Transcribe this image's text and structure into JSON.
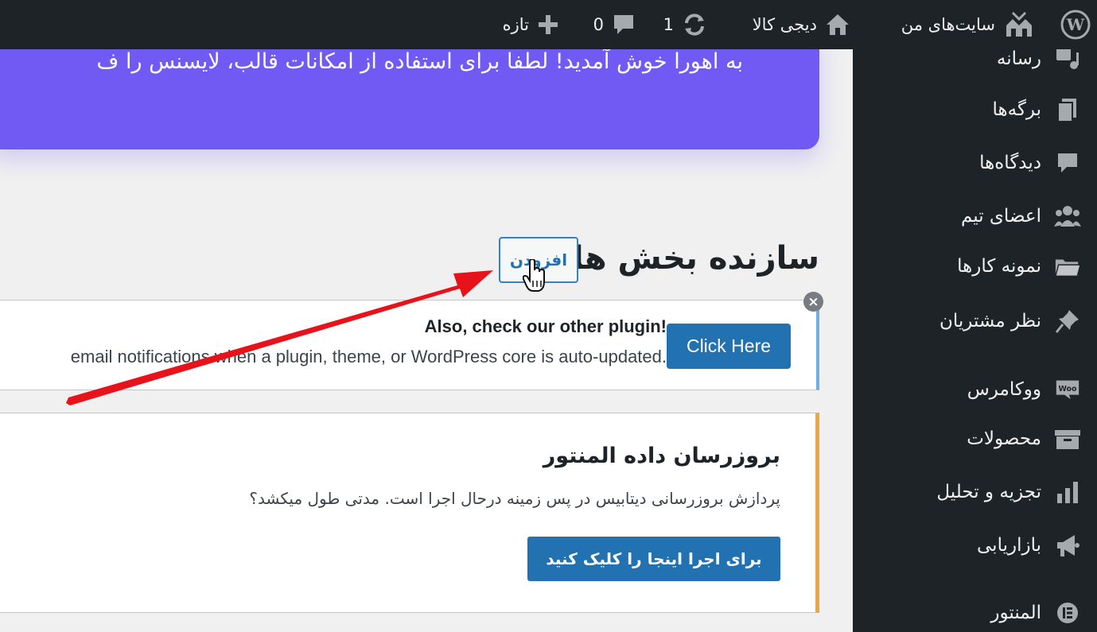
{
  "adminbar": {
    "site_name": "سایت‌های من",
    "shop_name": "دیجی کالا",
    "updates_count": "1",
    "comments_count": "0",
    "new_label": "تازه"
  },
  "sidebar": {
    "items": [
      {
        "label": "رسانه",
        "icon": "media-icon"
      },
      {
        "label": "برگه‌ها",
        "icon": "pages-icon"
      },
      {
        "label": "دیدگاه‌ها",
        "icon": "comments-icon"
      },
      {
        "label": "اعضای تیم",
        "icon": "team-icon"
      },
      {
        "label": "نمونه کارها",
        "icon": "portfolio-icon"
      },
      {
        "label": "نظر مشتریان",
        "icon": "pin-icon"
      },
      {
        "label": "ووکامرس",
        "icon": "woo-icon"
      },
      {
        "label": "محصولات",
        "icon": "products-icon"
      },
      {
        "label": "تجزیه و تحلیل",
        "icon": "analytics-icon"
      },
      {
        "label": "بازاریابی",
        "icon": "marketing-icon"
      },
      {
        "label": "المنتور",
        "icon": "elementor-icon"
      }
    ]
  },
  "welcome": {
    "text": "به اهورا خوش آمدید! لطفا برای استفاده از امکانات قالب، لایسنس را ف"
  },
  "page": {
    "heading": "سازنده بخش ها",
    "add_button": "افزودن"
  },
  "plugin_notice": {
    "title": "Also, check our other plugin!",
    "description": "email notifications when a plugin, theme, or WordPress core is auto-updated.",
    "button": "Click Here",
    "dismiss": "×"
  },
  "elementor_notice": {
    "title": "بروزرسان داده المنتور",
    "description": "پردازش بروزرسانی دیتابیس در پس زمینه درحال اجرا است. مدتی طول میکشد؟",
    "button": "برای اجرا اینجا را کلیک کنید"
  },
  "colors": {
    "adminbar_bg": "#1d2327",
    "welcome_bg": "#7159f4",
    "primary_button": "#2271b1",
    "notice_info_border": "#72aee6",
    "notice_warning_border": "#f0a63a",
    "annotation_arrow": "#e8121a"
  }
}
